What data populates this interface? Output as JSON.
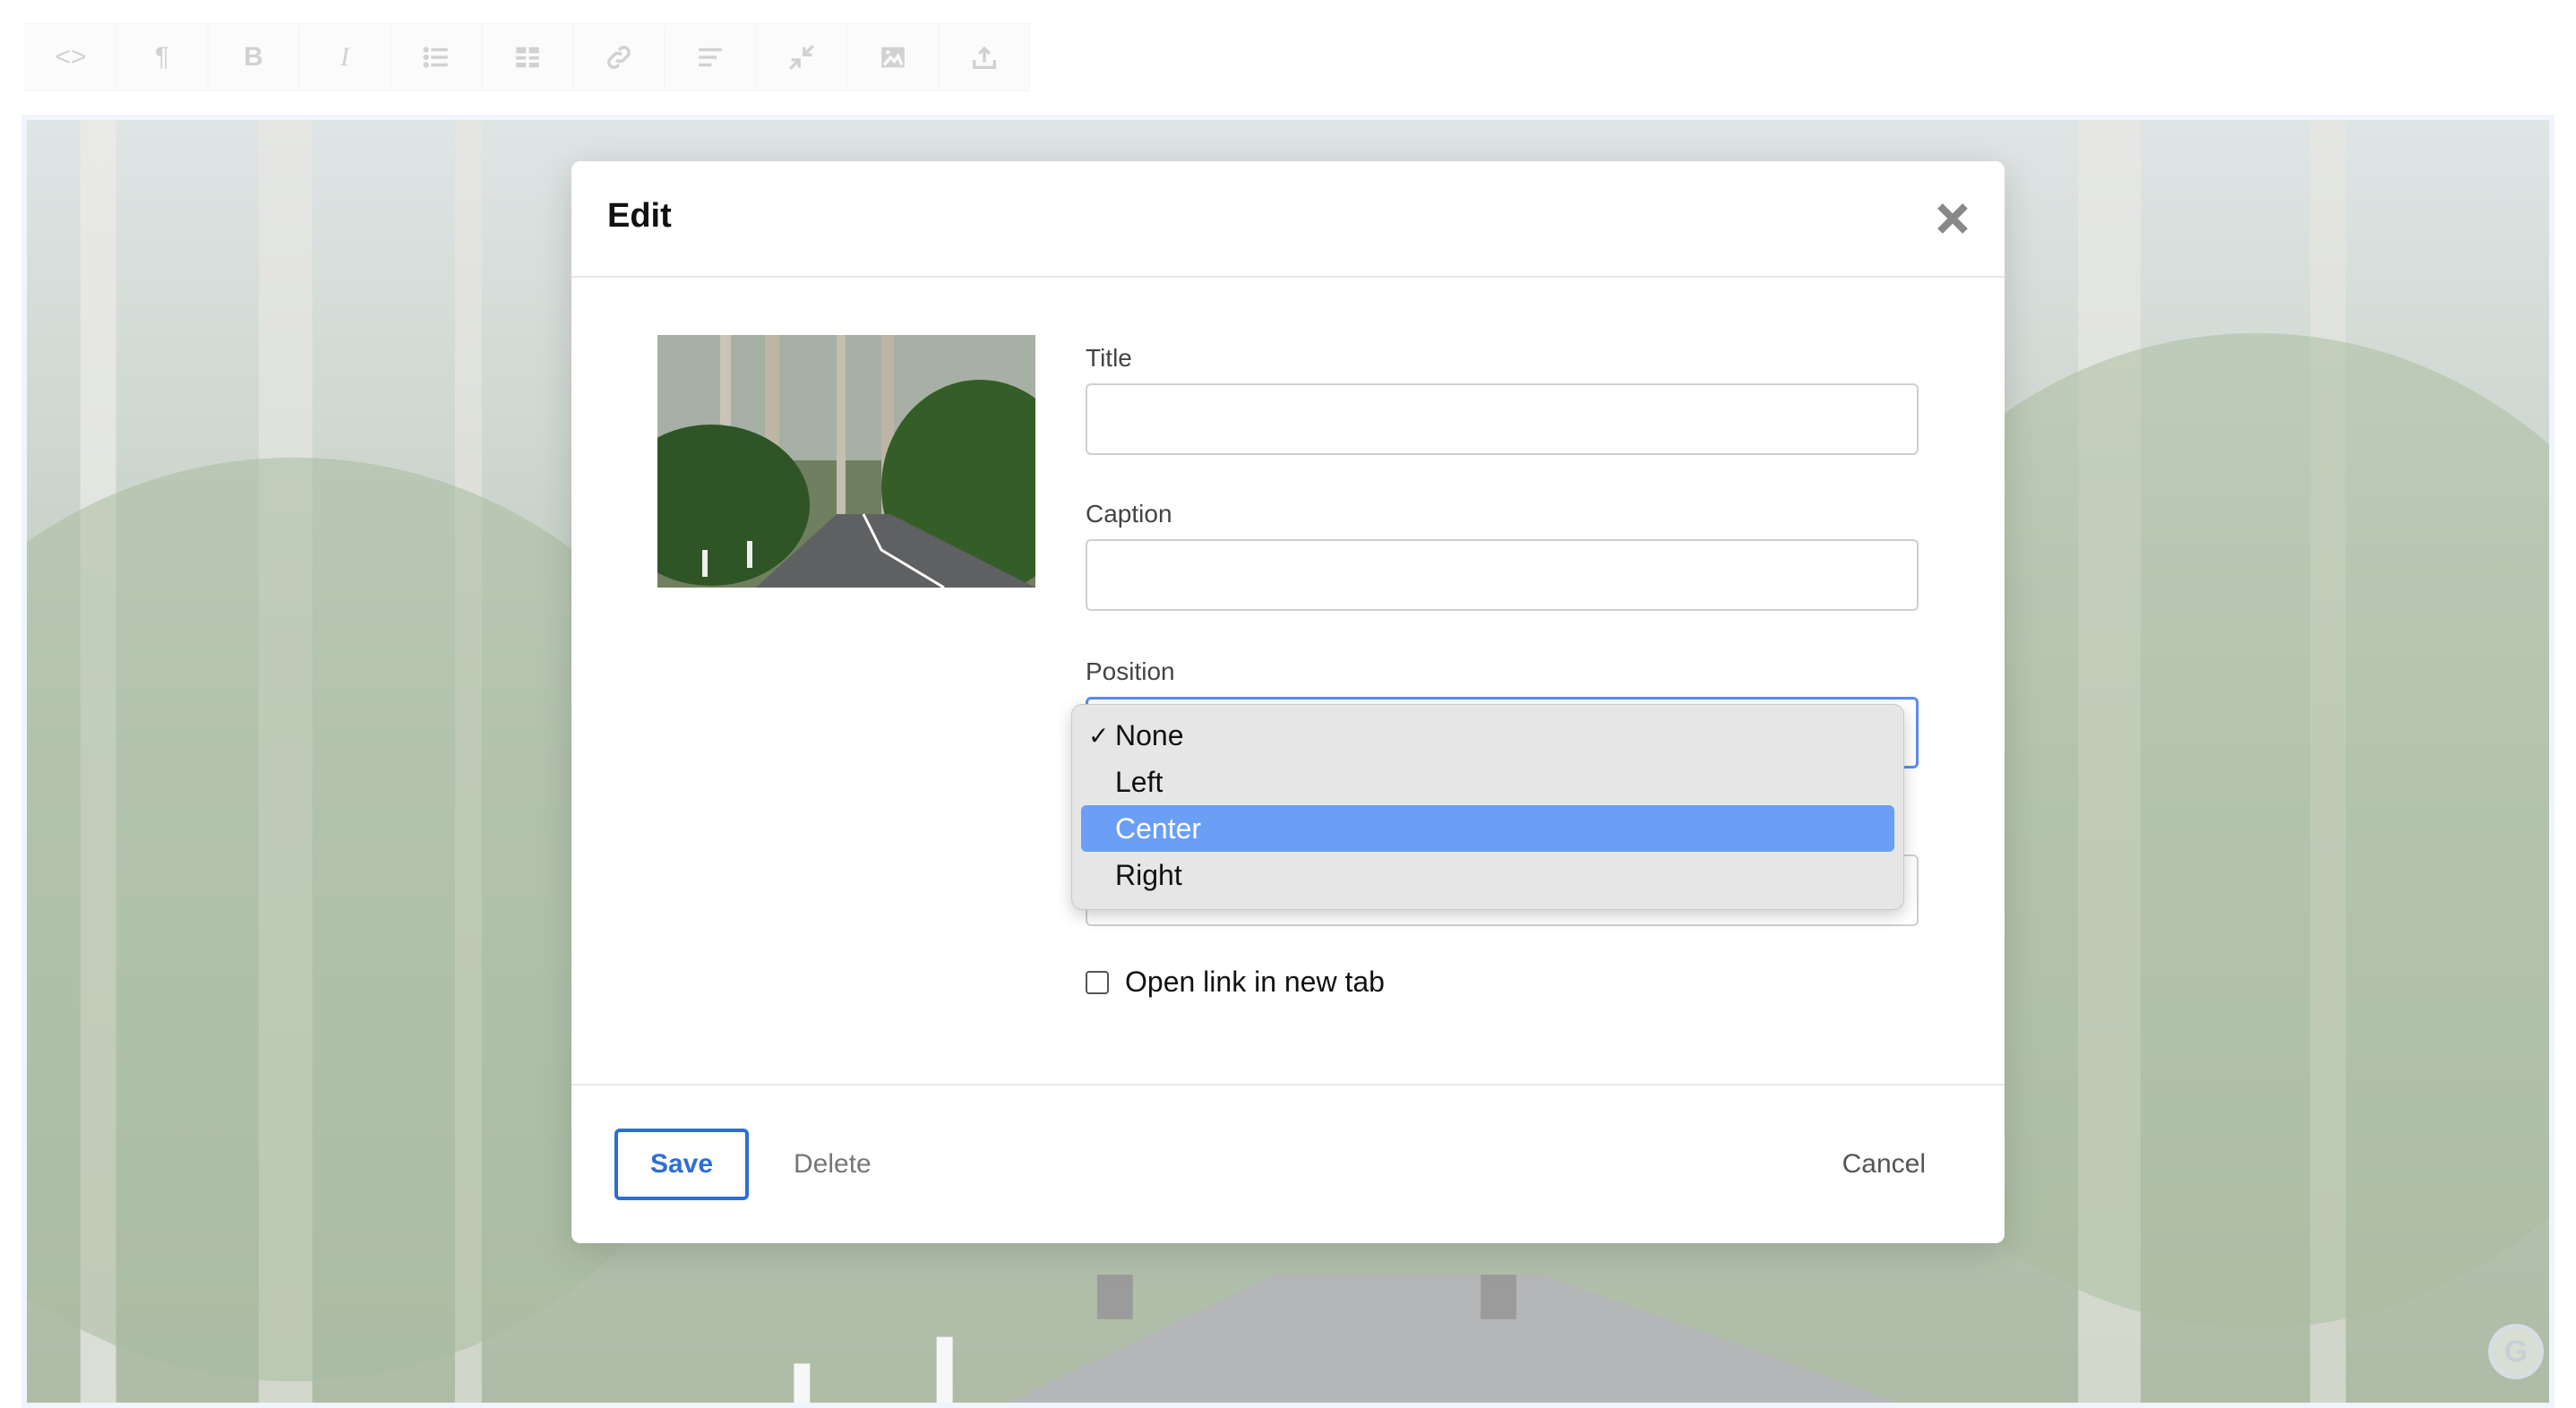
{
  "toolbar": {
    "buttons": [
      {
        "name": "html-icon",
        "glyph": "<>"
      },
      {
        "name": "paragraph-icon",
        "glyph": "¶"
      },
      {
        "name": "bold-icon",
        "glyph": "B"
      },
      {
        "name": "italic-icon",
        "glyph": "I"
      },
      {
        "name": "list-icon",
        "glyph": ""
      },
      {
        "name": "table-icon",
        "glyph": ""
      },
      {
        "name": "link-icon",
        "glyph": ""
      },
      {
        "name": "align-icon",
        "glyph": ""
      },
      {
        "name": "fullscreen-icon",
        "glyph": ""
      },
      {
        "name": "image-icon",
        "glyph": ""
      },
      {
        "name": "upload-icon",
        "glyph": ""
      }
    ]
  },
  "modal": {
    "title": "Edit",
    "fields": {
      "title_label": "Title",
      "title_value": "",
      "caption_label": "Caption",
      "caption_value": "",
      "position_label": "Position",
      "position_selected": "None",
      "open_new_tab_label": "Open link in new tab"
    },
    "footer": {
      "save": "Save",
      "delete": "Delete",
      "cancel": "Cancel"
    }
  },
  "dropdown": {
    "options": [
      "None",
      "Left",
      "Center",
      "Right"
    ],
    "checked": "None",
    "highlighted": "Center",
    "check_glyph": "✓"
  },
  "colors": {
    "accent": "#2d6fd3",
    "focus": "#5b8def",
    "highlight": "#6a9ff5"
  }
}
